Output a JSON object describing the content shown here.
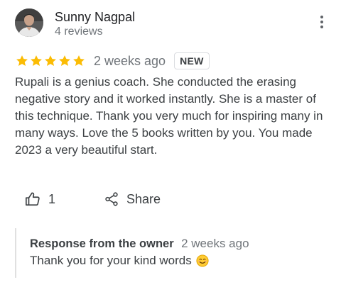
{
  "reviewer": {
    "name": "Sunny Nagpal",
    "review_count": "4 reviews"
  },
  "rating": {
    "stars": 5,
    "max_stars": 5,
    "star_color": "#fbbc04",
    "time": "2 weeks ago",
    "badge": "NEW"
  },
  "review": {
    "text": "Rupali is a genius coach. She conducted the erasing negative story and it worked instantly. She is a master of this technique. Thank you very much for inspiring many in many ways. Love the 5 books written by you. You made 2023 a very beautiful start."
  },
  "actions": {
    "like_count": "1",
    "share_label": "Share",
    "like_icon": "thumbs-up-icon",
    "share_icon": "share-icon"
  },
  "owner_response": {
    "title": "Response from the owner",
    "time": "2 weeks ago",
    "text": "Thank you for your kind words",
    "emoji_icon": "smiling-face-emoji"
  },
  "icons": {
    "menu": "more-vert-icon",
    "avatar": "avatar"
  }
}
